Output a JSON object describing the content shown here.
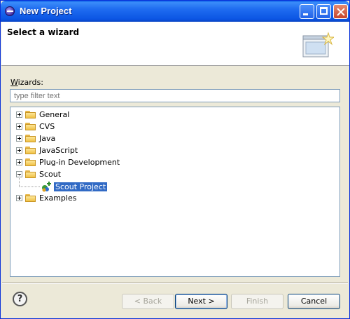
{
  "window": {
    "title": "New Project"
  },
  "banner": {
    "title": "Select a wizard"
  },
  "wizards": {
    "label_prefix": "W",
    "label_rest": "izards:",
    "filter_placeholder": "type filter text"
  },
  "tree": {
    "items": [
      {
        "label": "General",
        "state": "collapsed"
      },
      {
        "label": "CVS",
        "state": "collapsed"
      },
      {
        "label": "Java",
        "state": "collapsed"
      },
      {
        "label": "JavaScript",
        "state": "collapsed"
      },
      {
        "label": "Plug-in Development",
        "state": "collapsed"
      },
      {
        "label": "Scout",
        "state": "expanded"
      },
      {
        "label": "Scout Project",
        "state": "selected"
      },
      {
        "label": "Examples",
        "state": "collapsed"
      }
    ]
  },
  "buttons": {
    "help": "?",
    "back": "< Back",
    "next": "Next >",
    "finish": "Finish",
    "cancel": "Cancel"
  }
}
